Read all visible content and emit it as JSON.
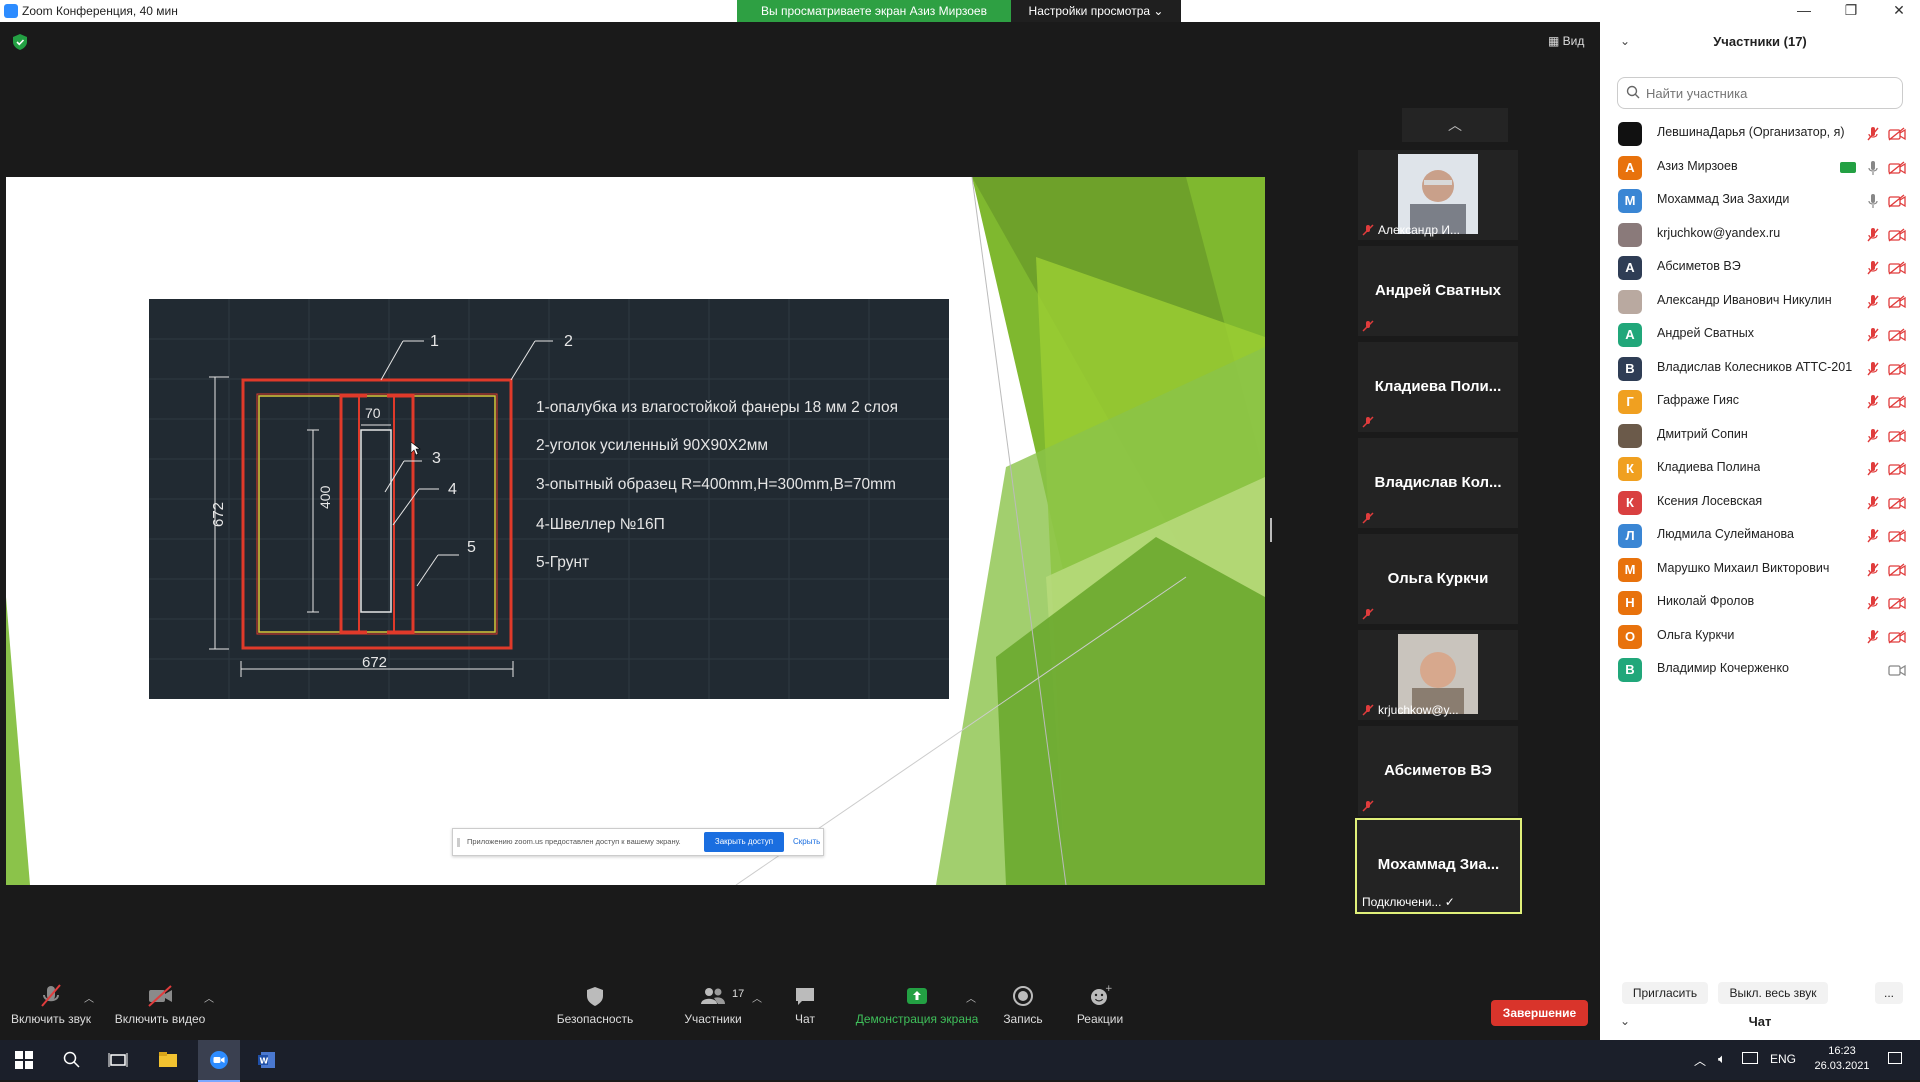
{
  "window": {
    "title": "Zoom Конференция, 40 мин",
    "viewing_banner": "Вы просматриваете экран Азиз Мирзоев",
    "view_options": "Настройки просмотра",
    "view_button": "Вид"
  },
  "slide": {
    "dims": [
      "1",
      "2",
      "70",
      "3",
      "4",
      "400",
      "5",
      "672",
      "672"
    ],
    "legend": [
      "1-опалубка из влагостойкой фанеры 18 мм 2 слоя",
      "2-уголок усиленный 90Х90Х2мм",
      "3-опытный образец R=400mm,H=300mm,B=70mm",
      "4-Швеллер №16П",
      "5-Грунт"
    ],
    "notification": {
      "text": "Приложению zoom.us предоставлен доступ к вашему экрану.",
      "stop_label": "Закрыть доступ",
      "hide_label": "Скрыть"
    }
  },
  "thumbnails": [
    {
      "label": "Александр И...",
      "type": "video"
    },
    {
      "label": "Андрей Сватных",
      "type": "name"
    },
    {
      "label": "Кладиева  Поли...",
      "type": "name"
    },
    {
      "label": "Владислав  Кол...",
      "type": "name"
    },
    {
      "label": "Ольга Куркчи",
      "type": "name"
    },
    {
      "label": "krjuchkow@y...",
      "type": "video"
    },
    {
      "label": "Абсиметов ВЭ",
      "type": "name"
    },
    {
      "label": "Мохаммад  Зиа...",
      "status": "Подключени... ✓",
      "type": "active"
    }
  ],
  "toolbar": {
    "mute": "Включить звук",
    "video": "Включить видео",
    "security": "Безопасность",
    "participants": "Участники",
    "participants_count": "17",
    "chat": "Чат",
    "share": "Демонстрация экрана",
    "record": "Запись",
    "reactions": "Реакции",
    "end": "Завершение"
  },
  "panel": {
    "title": "Участники (17)",
    "search_placeholder": "Найти участника",
    "participants": [
      {
        "name": "ЛевшинаДарья (Организатор, я)",
        "initial": "",
        "color": "#111111",
        "mic": "muted",
        "video": "off"
      },
      {
        "name": "Азиз Мирзоев",
        "initial": "А",
        "color": "#e8720c",
        "mic": "on",
        "video": "off",
        "sharing": true
      },
      {
        "name": "Мохаммад Зиа Захиди",
        "initial": "М",
        "color": "#3a86d4",
        "mic": "on",
        "video": "off"
      },
      {
        "name": "krjuchkow@yandex.ru",
        "initial": "",
        "color": "#8a7a7a",
        "mic": "muted",
        "video": "off"
      },
      {
        "name": "Абсиметов ВЭ",
        "initial": "А",
        "color": "#2f3d55",
        "mic": "muted",
        "video": "off"
      },
      {
        "name": "Александр Иванович Никулин",
        "initial": "",
        "color": "#b9a9a0",
        "mic": "muted",
        "video": "off"
      },
      {
        "name": "Андрей Сватных",
        "initial": "А",
        "color": "#21a77a",
        "mic": "muted",
        "video": "off"
      },
      {
        "name": "Владислав Колесников АТТС-201",
        "initial": "В",
        "color": "#2f3d55",
        "mic": "muted",
        "video": "off"
      },
      {
        "name": "Гафраже Гияс",
        "initial": "Г",
        "color": "#f0a020",
        "mic": "muted",
        "video": "off"
      },
      {
        "name": "Дмитрий Сопин",
        "initial": "",
        "color": "#6b5a4a",
        "mic": "muted",
        "video": "off"
      },
      {
        "name": "Кладиева Полина",
        "initial": "К",
        "color": "#f0a020",
        "mic": "muted",
        "video": "off"
      },
      {
        "name": "Ксения Лосевская",
        "initial": "К",
        "color": "#d94040",
        "mic": "muted",
        "video": "off"
      },
      {
        "name": "Людмила Сулейманова",
        "initial": "Л",
        "color": "#3a86d4",
        "mic": "muted",
        "video": "off"
      },
      {
        "name": "Марушко Михаил Викторович",
        "initial": "М",
        "color": "#e8720c",
        "mic": "muted",
        "video": "off"
      },
      {
        "name": "Николай Фролов",
        "initial": "Н",
        "color": "#e8720c",
        "mic": "muted",
        "video": "off"
      },
      {
        "name": "Ольга Куркчи",
        "initial": "О",
        "color": "#e8720c",
        "mic": "muted",
        "video": "off"
      },
      {
        "name": "Владимир Кочерженко",
        "initial": "В",
        "color": "#21a77a",
        "mic": "none",
        "video": "gray"
      }
    ],
    "invite": "Пригласить",
    "mute_all": "Выкл. весь звук",
    "more": "...",
    "chat_header": "Чат"
  },
  "taskbar": {
    "lang": "ENG",
    "time": "16:23",
    "date": "26.03.2021"
  },
  "colors": {
    "accent": "#2d8cff",
    "share_green": "#23a043",
    "end_red": "#d9342b",
    "muted_red": "#e03c3c"
  }
}
